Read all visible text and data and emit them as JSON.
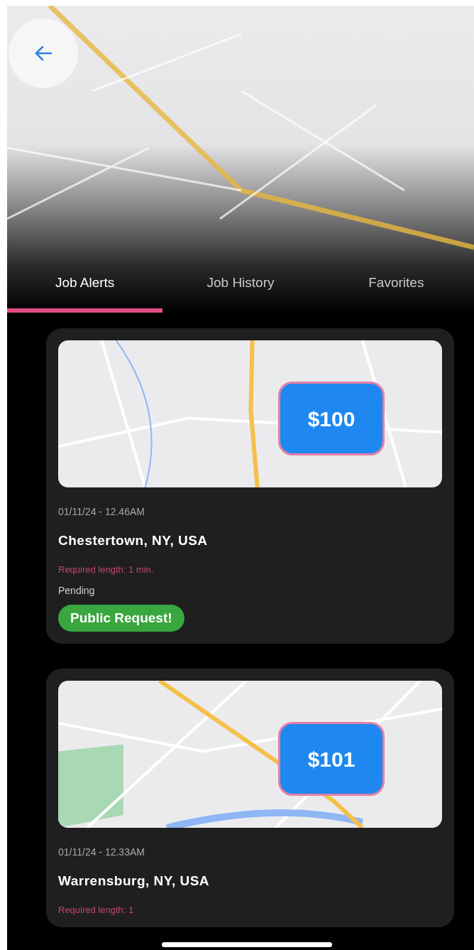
{
  "tabs": [
    {
      "label": "Job Alerts",
      "selected": true
    },
    {
      "label": "Job History",
      "selected": false
    },
    {
      "label": "Favorites",
      "selected": false
    }
  ],
  "jobs": [
    {
      "price": "$100",
      "date": "01/11/24 - 12.46AM",
      "location": "Chestertown, NY, USA",
      "required_length": "Required length: 1 min.",
      "status": "Pending",
      "badge": "Public Request!"
    },
    {
      "price": "$101",
      "date": "01/11/24 - 12.33AM",
      "location": "Warrensburg, NY, USA",
      "required_length": "Required length: 1"
    }
  ]
}
